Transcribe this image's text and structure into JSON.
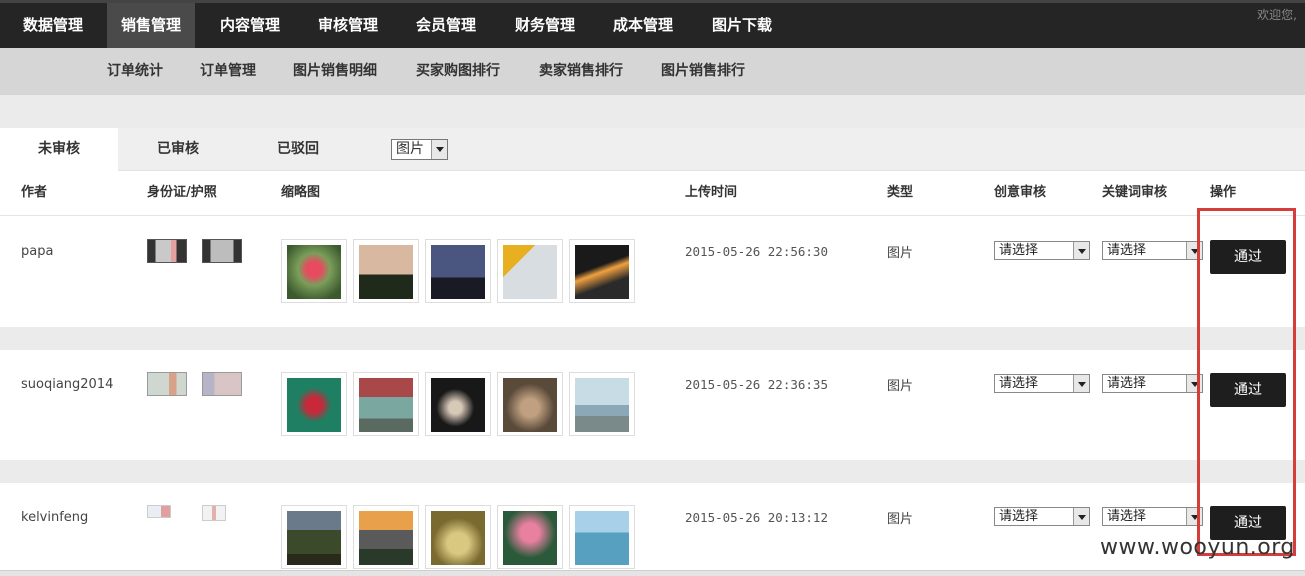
{
  "topnav": {
    "items": [
      "数据管理",
      "销售管理",
      "内容管理",
      "审核管理",
      "会员管理",
      "财务管理",
      "成本管理",
      "图片下载"
    ],
    "active_index": 1,
    "welcome": "欢迎您,"
  },
  "subnav": {
    "items": [
      "订单统计",
      "订单管理",
      "图片销售明细",
      "买家购图排行",
      "卖家销售排行",
      "图片销售排行"
    ]
  },
  "tabs": {
    "items": [
      "未审核",
      "已审核",
      "已驳回"
    ],
    "active_index": 0,
    "type_filter": "图片"
  },
  "table": {
    "headers": [
      "作者",
      "身份证/护照",
      "缩略图",
      "上传时间",
      "类型",
      "创意审核",
      "关键词审核",
      "操作"
    ],
    "rows": [
      {
        "author": "papa",
        "upload_time": "2015-05-26 22:56:30",
        "type": "图片",
        "creative_review": "请选择",
        "keyword_review": "请选择",
        "action": "通过"
      },
      {
        "author": "suoqiang2014",
        "upload_time": "2015-05-26 22:36:35",
        "type": "图片",
        "creative_review": "请选择",
        "keyword_review": "请选择",
        "action": "通过"
      },
      {
        "author": "kelvinfeng",
        "upload_time": "2015-05-26 20:13:12",
        "type": "图片",
        "creative_review": "请选择",
        "keyword_review": "请选择",
        "action": "通过"
      }
    ]
  },
  "watermark": "www.wooyun.org",
  "colors": {
    "topbar": "#252525",
    "active_nav": "#4a4a4a",
    "subnav": "#d6d6d6",
    "button": "#1e1e1e",
    "highlight_box": "#d63c3c"
  }
}
